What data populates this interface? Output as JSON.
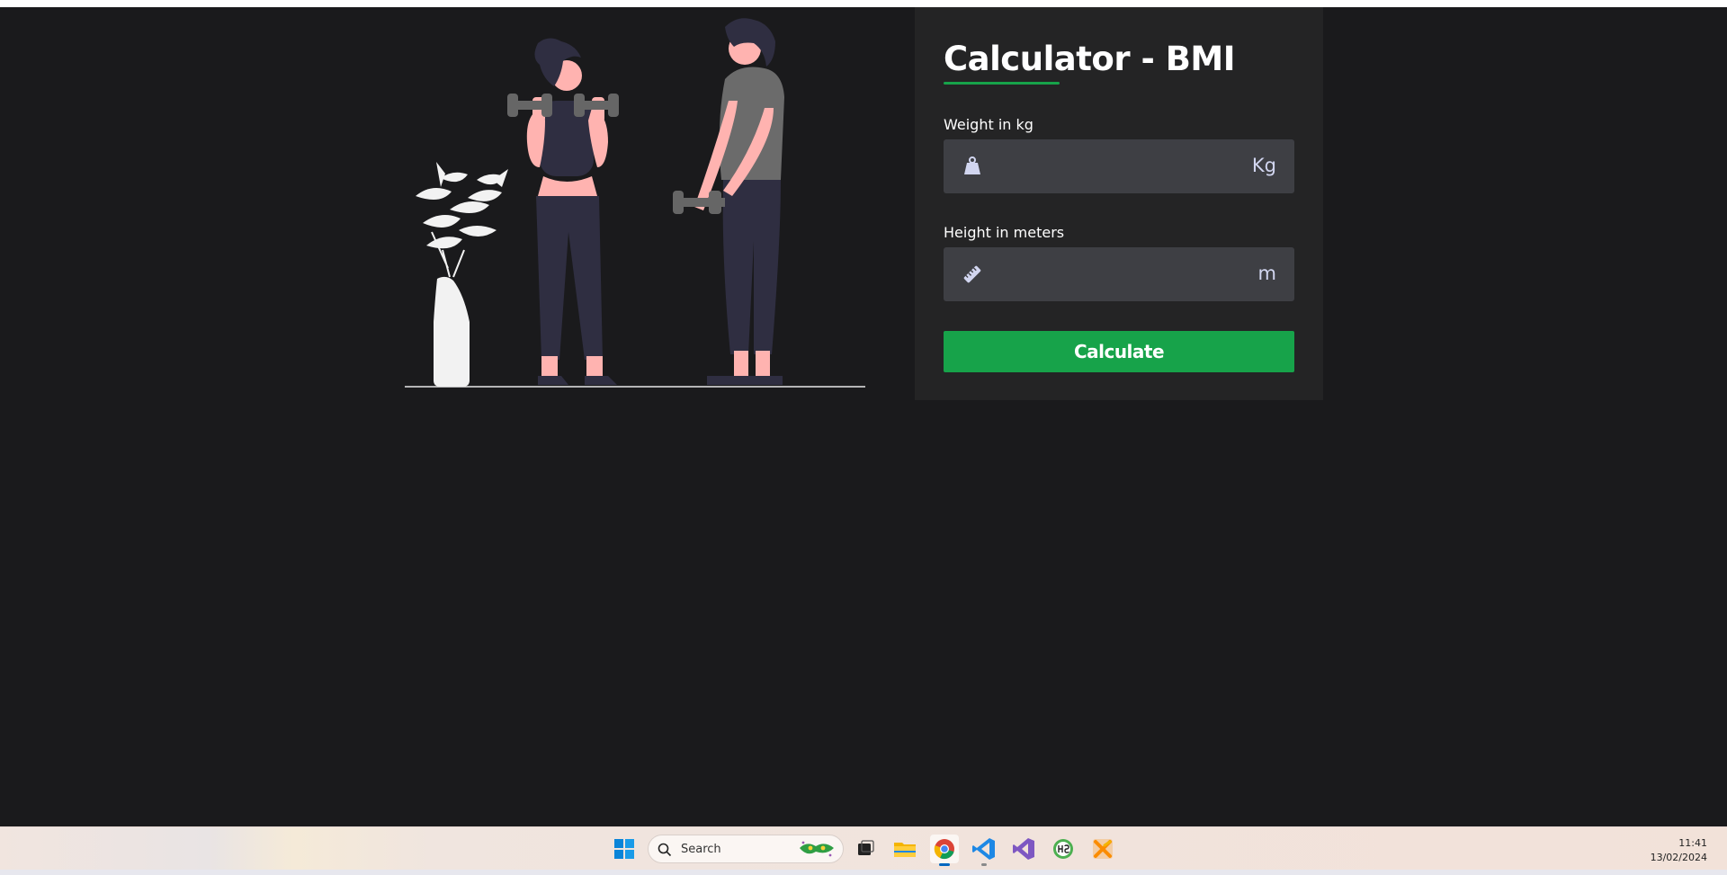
{
  "card": {
    "title": "Calculator - BMI",
    "weight": {
      "label": "Weight in kg",
      "unit": "Kg",
      "value": "",
      "placeholder": "",
      "icon": "weight-icon"
    },
    "height": {
      "label": "Height in meters",
      "unit": "m",
      "value": "",
      "placeholder": "",
      "icon": "ruler-icon"
    },
    "button_label": "Calculate"
  },
  "colors": {
    "background": "#1a1a1c",
    "card": "#242425",
    "input": "#3e3f44",
    "accent": "#17a34a"
  },
  "taskbar": {
    "search_label": "Search",
    "apps": [
      "task-view-icon",
      "file-explorer-icon",
      "chrome-icon",
      "vscode-icon",
      "visual-studio-icon",
      "heidisql-icon",
      "xampp-icon"
    ],
    "time": "11:41",
    "date": "13/02/2024"
  }
}
